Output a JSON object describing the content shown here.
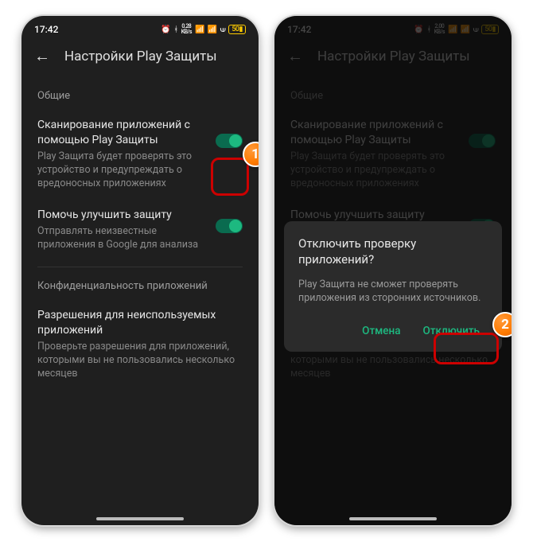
{
  "statusbar": {
    "time": "17:42",
    "net_speed_value": "0.28",
    "net_speed_unit": "KB/s",
    "net_speed_value2": "2.00",
    "battery_pct": "50"
  },
  "header": {
    "title": "Настройки Play Защиты"
  },
  "sections": {
    "general_label": "Общие",
    "privacy_label": "Конфиденциальность приложений"
  },
  "settings": {
    "scan": {
      "title": "Сканирование приложений с помощью Play Защиты",
      "desc": "Play Защита будет проверять это устройство и предупреждать о вредоносных приложениях"
    },
    "improve": {
      "title": "Помочь улучшить защиту",
      "desc": "Отправлять неизвестные приложения в Google для анализа"
    },
    "perms": {
      "title": "Разрешения для неиспользуемых приложений",
      "desc": "Проверьте разрешения для приложений, которыми вы не пользовались несколько месяцев"
    }
  },
  "dialog": {
    "title": "Отключить проверку приложений?",
    "body": "Play Защита не сможет проверять приложения из сторонних источников.",
    "cancel": "Отмена",
    "confirm": "Отключить"
  },
  "callouts": {
    "one": "1",
    "two": "2"
  }
}
